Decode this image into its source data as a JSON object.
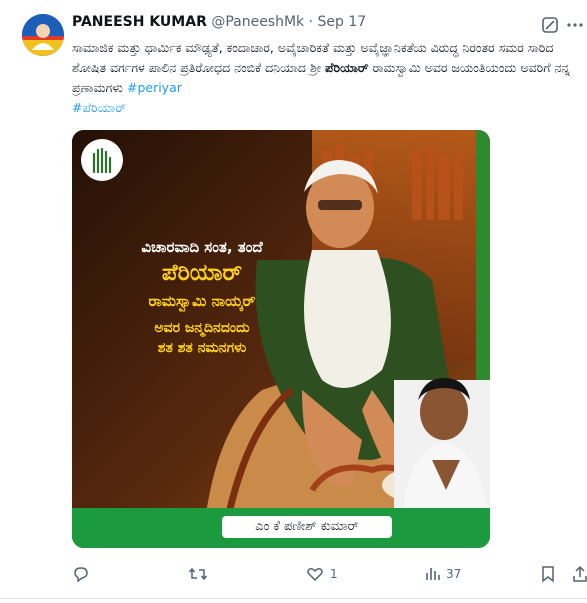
{
  "tweet": {
    "display_name": "PANEESH KUMAR",
    "handle": "@PaneeshMk",
    "separator": "·",
    "timestamp": "Sep 17",
    "text_part1": "ಸಾಮಾಜಿಕ ಮತ್ತು ಧಾರ್ಮಿಕ ಮೌಢ್ಯತೆ, ಕಂದಾಚಾರ, ಅವೈಚಾರಿಕತೆ ಮತ್ತು ಅವೈಜ್ಞಾನಿಕತೆಯ ವಿರುದ್ಧ ನಿರಂತರ ಸಮರ ಸಾರಿದ ಶೋಷಿತ ವರ್ಗಗಳ ಪಾಲಿನ ಪ್ರತಿರೋಧದ ನಂಬಿಕೆ ದನಿಯಾದ ಶ್ರೀ ",
    "text_bold": "ಪೆರಿಯಾರ್",
    "text_part2": " ರಾಮಸ್ವಾಮಿ ಅವರ ಜಯಂತಿಯಂದು ಅವರಿಗೆ ನನ್ನ ಪ್ರಣಾಮಗಳು ",
    "hashtag1": "#periyar",
    "hashtag2": "#ಪೆರಿಯಾರ್"
  },
  "poster": {
    "line1": "ವಿಚಾರವಾದಿ ಸಂತ, ತಂದೆ",
    "line2": "ಪೆರಿಯಾರ್",
    "line3": "ರಾಮಸ್ವಾಮಿ ನಾಯ್ಕರ್",
    "line4": "ಅವರ ಜನ್ಮದಿನದಂದು",
    "line5": "ಶತ ಶತ ನಮನಗಳು",
    "name_label": "ಎಂ ಕೆ ಪಣೀಶ್ ಕುಮಾರ್"
  },
  "actions": {
    "reply_count": "",
    "retweet_count": "",
    "like_count": "1",
    "views_count": "37"
  },
  "icons": [
    "avatar",
    "grok-icon",
    "more-icon",
    "reply-icon",
    "retweet-icon",
    "like-icon",
    "views-icon",
    "bookmark-icon",
    "share-icon",
    "hand-logo-icon"
  ],
  "colors": {
    "hashtag": "#1d9bf0",
    "secondary_text": "#536471",
    "poster_green": "#1b9a3e",
    "poster_yellow": "#ffd21a"
  }
}
